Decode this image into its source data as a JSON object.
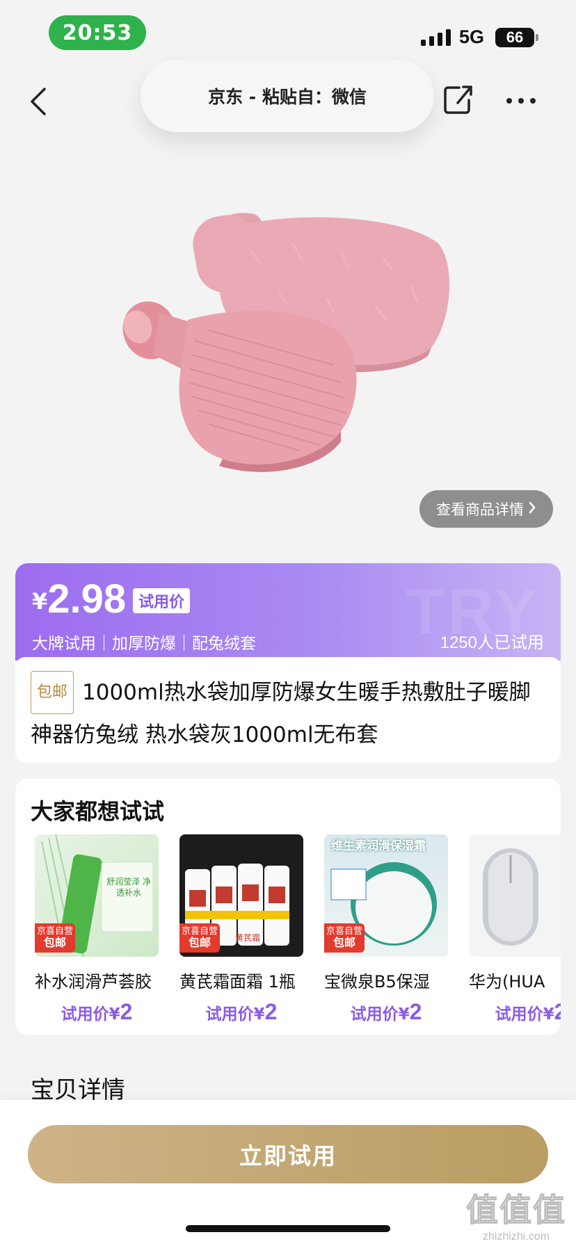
{
  "status_bar": {
    "time": "20:53",
    "network": "5G",
    "battery": "66"
  },
  "nav": {
    "title": "京东 - 粘贴自：微信",
    "icons": [
      "back-icon",
      "share-icon",
      "more-icon"
    ]
  },
  "product_image": {
    "detail_button": "查看商品详情",
    "colors": {
      "cover": "#e8a5b0",
      "bottle": "#e79aa4"
    }
  },
  "price": {
    "currency": "¥",
    "value": "2.98",
    "tag": "试用价",
    "features": "大牌试用｜加厚防爆｜配兔绒套",
    "tried_count": "1250人已试用",
    "watermark": "TRY",
    "accent": "#9d6cf0"
  },
  "product": {
    "badge": "包邮",
    "title": "1000ml热水袋加厚防爆女生暖手热敷肚子暖脚神器仿兔绒 热水袋灰1000ml无布套"
  },
  "recommend": {
    "title": "大家都想试试",
    "items": [
      {
        "name": "补水润滑芦荟胶",
        "price_label": "试用价¥",
        "price": "2",
        "badge_top": "京喜自营",
        "badge_bottom": "包邮",
        "thumb_text": "舒润莹泽 净透补水"
      },
      {
        "name": "黄芪霜面霜 1瓶",
        "price_label": "试用价¥",
        "price": "2",
        "badge_top": "京喜自营",
        "badge_bottom": "包邮",
        "thumb_text": "黄芪霜"
      },
      {
        "name": "宝微泉B5保湿",
        "price_label": "试用价¥",
        "price": "2",
        "badge_top": "京喜自营",
        "badge_bottom": "包邮",
        "thumb_text": "维生素润滑保湿霜"
      },
      {
        "name": "华为(HUA",
        "price_label": "试用价¥",
        "price": "2"
      }
    ]
  },
  "detail_heading": "宝贝详情",
  "cta": {
    "label": "立即试用"
  },
  "site_watermark": {
    "big": "值值值",
    "small": "zhizhizhi.com"
  }
}
